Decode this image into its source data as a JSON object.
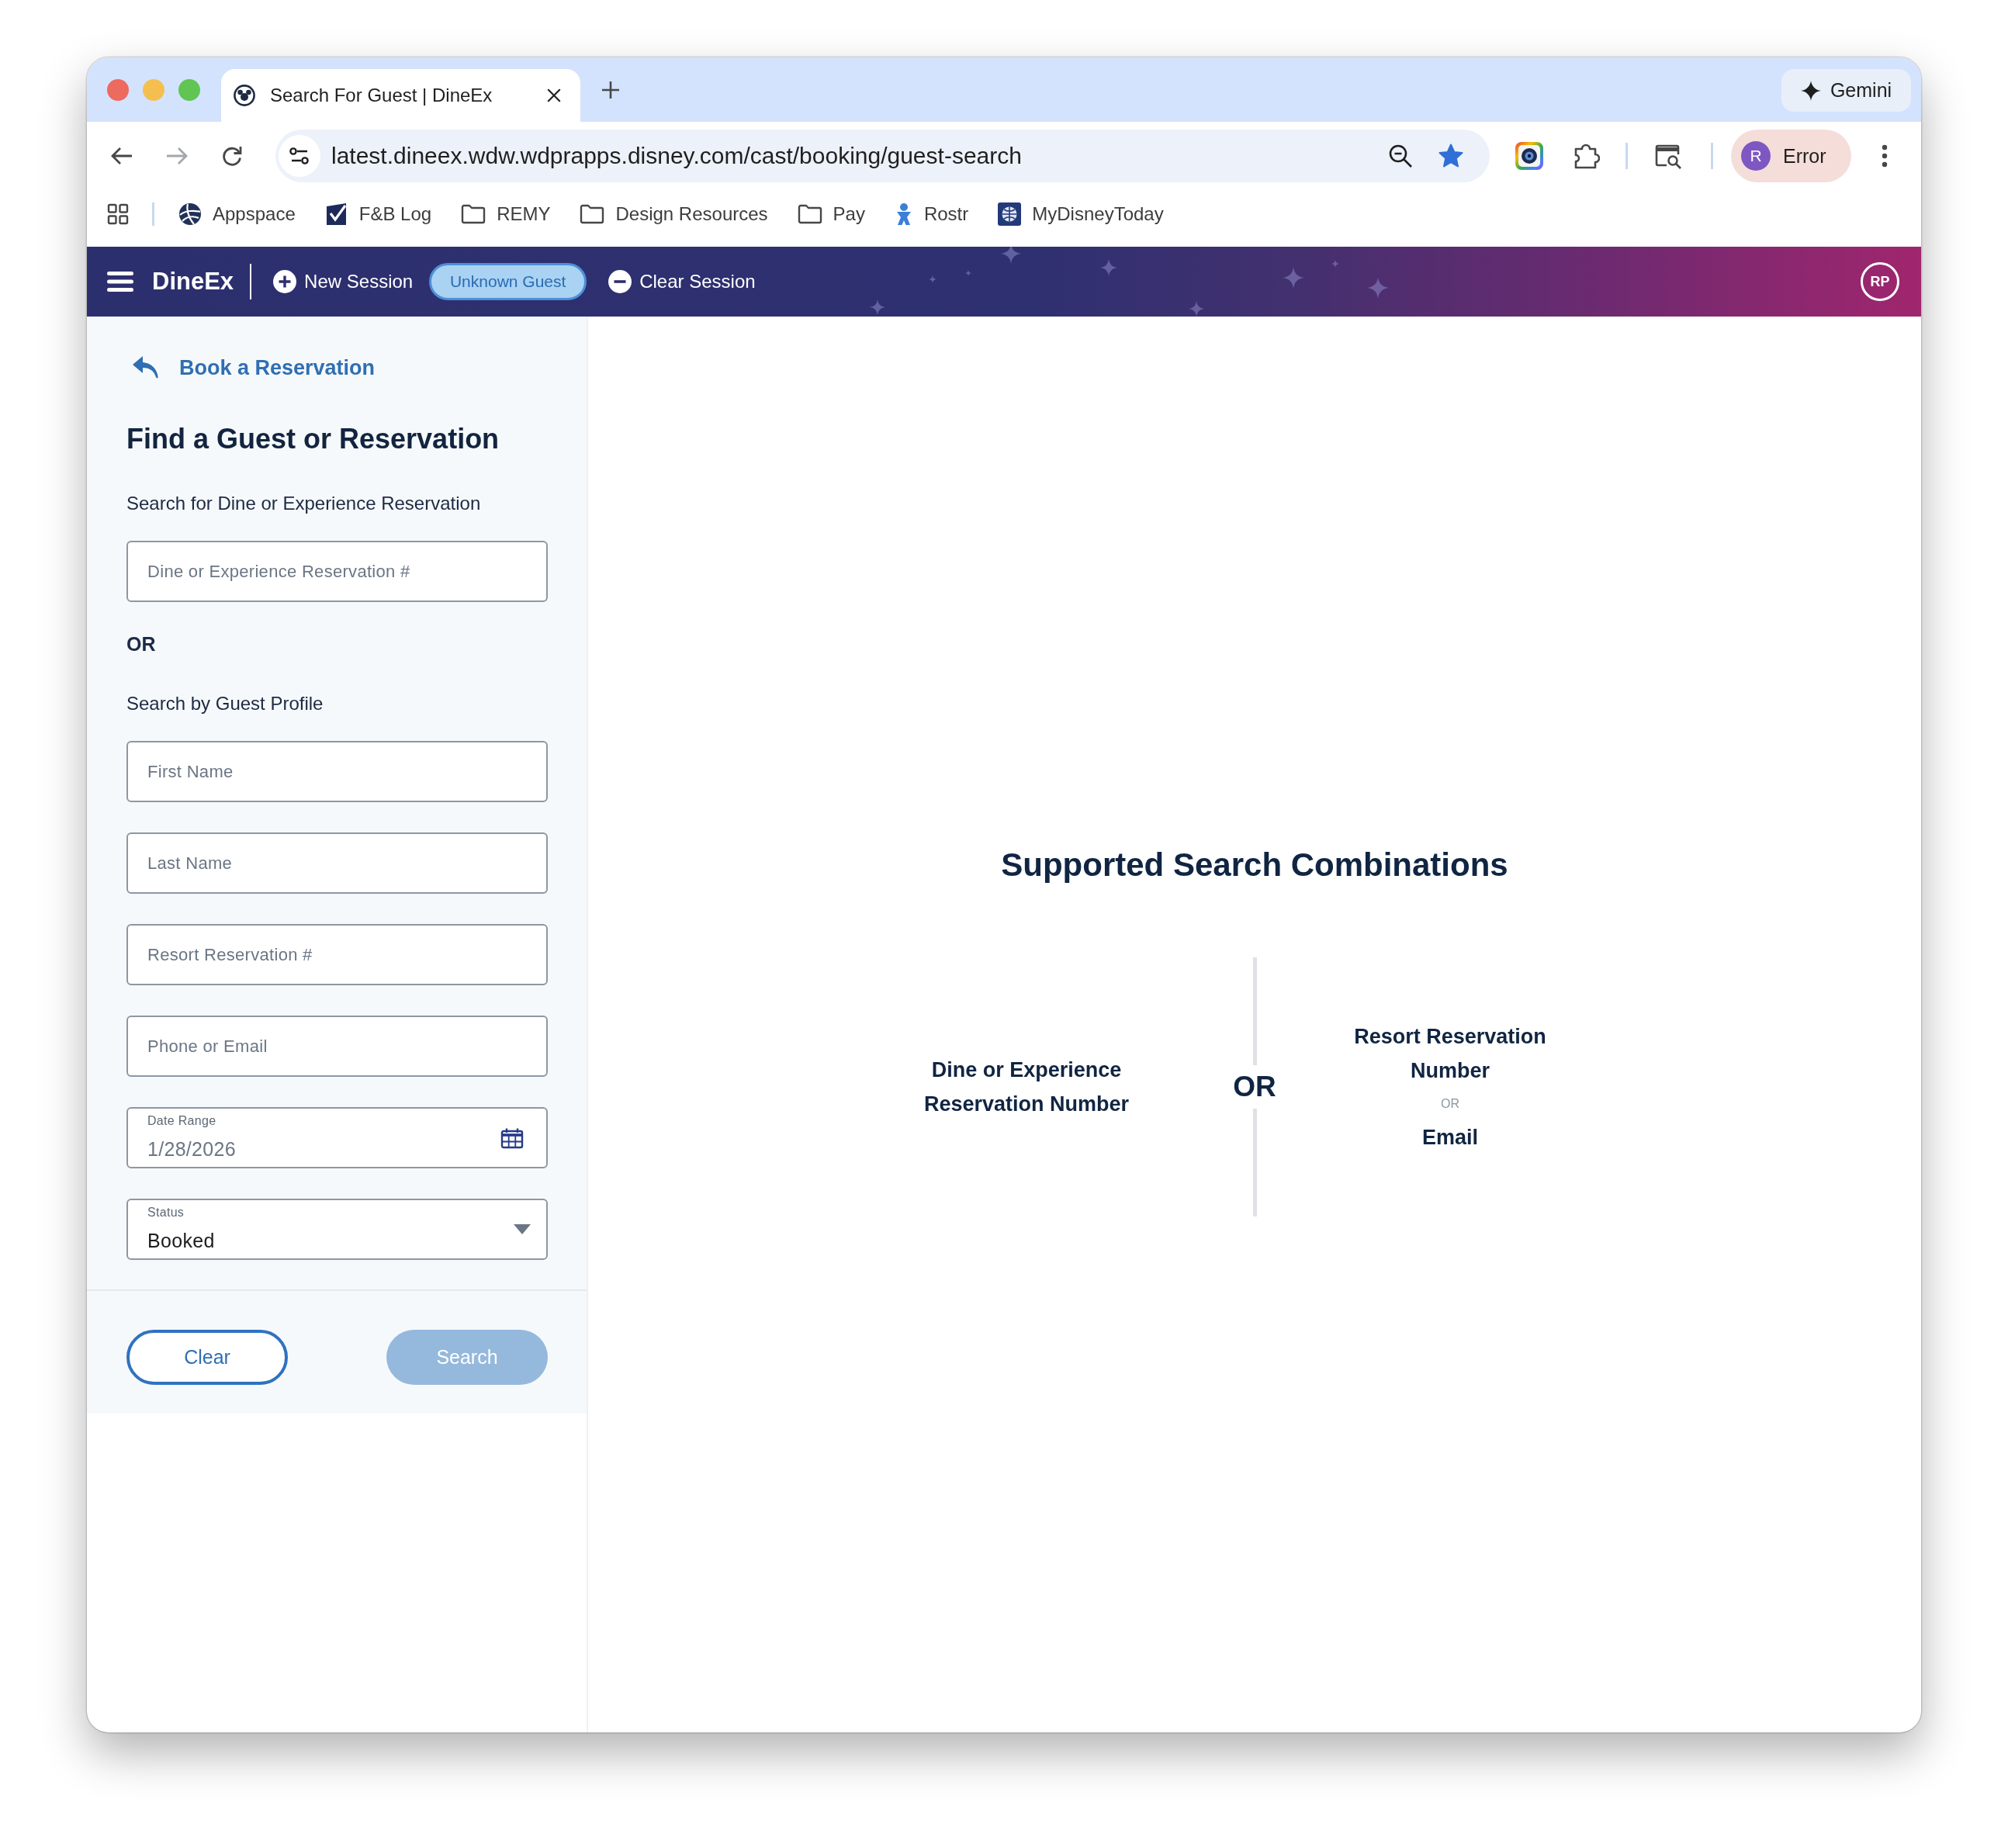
{
  "browser": {
    "tabs": [
      {
        "title": "Search For Guest | DineEx",
        "selected": true
      }
    ],
    "gemini": "Gemini",
    "nav": {
      "back_enabled": true,
      "forward_enabled": false
    },
    "url": "latest.dineex.wdw.wdprapps.disney.com/cast/booking/guest-search",
    "bookmarked": true,
    "profile": {
      "initial": "R",
      "label": "Error"
    },
    "bookmarks": [
      {
        "label": "Appspace",
        "kind": "globe"
      },
      {
        "label": "F&B Log",
        "kind": "check"
      },
      {
        "label": "REMY",
        "kind": "folder"
      },
      {
        "label": "Design Resources",
        "kind": "folder"
      },
      {
        "label": "Pay",
        "kind": "folder"
      },
      {
        "label": "Rostr",
        "kind": "figure"
      },
      {
        "label": "MyDisneyToday",
        "kind": "tile"
      }
    ]
  },
  "app_header": {
    "title": "DineEx",
    "actions": [
      {
        "label": "New Session",
        "kind": "add"
      },
      {
        "label": "Unknown Guest",
        "kind": "badge"
      },
      {
        "label": "Clear Session",
        "kind": "remove"
      }
    ],
    "user_initials": "RP"
  },
  "search_panel": {
    "back_link": "Book a Reservation",
    "title": "Find a Guest or Reservation",
    "items": [
      {
        "kind": "section",
        "text": "Search for Dine or Experience Reservation"
      },
      {
        "kind": "input",
        "placeholder": "Dine or Experience Reservation #"
      },
      {
        "kind": "or",
        "text": "OR"
      },
      {
        "kind": "section",
        "text": "Search by Guest Profile"
      },
      {
        "kind": "input",
        "placeholder": "First Name"
      },
      {
        "kind": "input",
        "placeholder": "Last Name"
      },
      {
        "kind": "input",
        "placeholder": "Resort Reservation #"
      },
      {
        "kind": "input",
        "placeholder": "Phone or Email"
      },
      {
        "kind": "date",
        "label": "Date Range",
        "value": "1/28/2026"
      },
      {
        "kind": "select",
        "label": "Status",
        "value": "Booked"
      }
    ],
    "buttons": [
      {
        "label": "Clear",
        "kind": "secondary",
        "disabled": false
      },
      {
        "label": "Search",
        "kind": "primary",
        "disabled": true
      }
    ]
  },
  "combinations": {
    "title": "Supported Search Combinations",
    "separator": "OR",
    "options": [
      {
        "parts": [
          {
            "kind": "field",
            "text": "Dine or Experience Reservation Number"
          }
        ]
      },
      {
        "parts": [
          {
            "kind": "field",
            "text": "Resort Reservation Number"
          },
          {
            "kind": "or",
            "text": "OR"
          },
          {
            "kind": "field",
            "text": "Email"
          }
        ]
      }
    ]
  }
}
